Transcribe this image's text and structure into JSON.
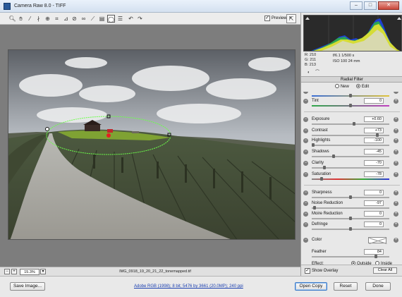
{
  "window": {
    "title": "Camera Raw 8.0  -  TIFF"
  },
  "toolbar": {
    "tools": [
      "zoom-icon",
      "hand-icon",
      "white-balance-icon",
      "color-sampler-icon",
      "targeted-adjust-icon",
      "crop-icon",
      "straighten-icon",
      "spot-removal-icon",
      "red-eye-icon",
      "adjustment-brush-icon",
      "graduated-filter-icon",
      "radial-filter-icon",
      "preferences-icon",
      "rotate-left-icon",
      "rotate-right-icon"
    ],
    "preview_label": "Preview",
    "preview_checked": true
  },
  "readout": {
    "r": "R:  210",
    "g": "G:  211",
    "b": "B:  213",
    "aperture_shutter": "f/6.1   1/500 s",
    "iso_focal": "ISO 100   24 mm"
  },
  "panel": {
    "section_title": "Radial Filter",
    "mode_new": "New",
    "mode_edit": "Edit",
    "sliders": [
      {
        "label": "Temperature",
        "value": "",
        "pos": 0.5,
        "partial": true
      },
      {
        "label": "Tint",
        "value": "0",
        "pos": 0.5
      },
      {
        "label": "Exposure",
        "value": "+0.60",
        "pos": 0.55
      },
      {
        "label": "Contrast",
        "value": "+73",
        "pos": 0.86
      },
      {
        "label": "Highlights",
        "value": "-100",
        "pos": 0.0
      },
      {
        "label": "Shadows",
        "value": "-45",
        "pos": 0.27
      },
      {
        "label": "Clarity",
        "value": "-70",
        "pos": 0.15
      },
      {
        "label": "Saturation",
        "value": "-78",
        "pos": 0.11
      },
      {
        "label": "Sharpness",
        "value": "0",
        "pos": 0.5
      },
      {
        "label": "Noise Reduction",
        "value": "-97",
        "pos": 0.02
      },
      {
        "label": "Moire Reduction",
        "value": "0",
        "pos": 0.5
      },
      {
        "label": "Defringe",
        "value": "0",
        "pos": 0.5
      }
    ],
    "color_label": "Color",
    "feather_label": "Feather",
    "feather_value": "84",
    "feather_pos": 0.84,
    "effect_label": "Effect:",
    "effect_outside": "Outside",
    "effect_inside": "Inside",
    "show_overlay_label": "Show Overlay",
    "clear_all_label": "Clear All"
  },
  "status": {
    "zoom": "15.3%",
    "filename": "IMG_0918_19_20_21_22_tonemapped.tif"
  },
  "footer": {
    "save_image": "Save Image...",
    "workflow_link": "Adobe RGB (1998); 8 bit; 5476 by 3661 (20.0MP); 240 ppi",
    "open_copy": "Open Copy",
    "reset": "Reset",
    "done": "Done"
  },
  "colors": {
    "accent": "#3d7bc9",
    "link": "#1a3fb0",
    "overlay_green": "#6cff4a"
  }
}
